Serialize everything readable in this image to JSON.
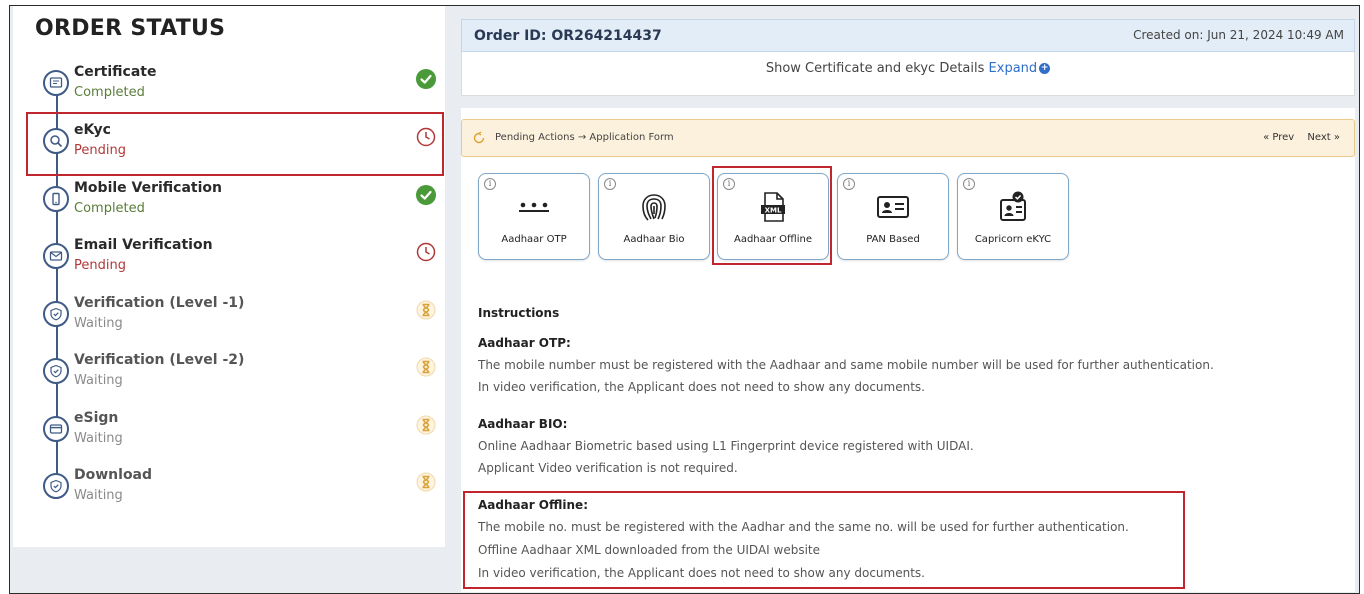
{
  "order_status": {
    "title": "ORDER STATUS",
    "steps": [
      {
        "title": "Certificate",
        "status": "Completed",
        "state": "done",
        "icon": "certificate-icon"
      },
      {
        "title": "eKyc",
        "status": "Pending",
        "state": "pending",
        "icon": "search-icon"
      },
      {
        "title": "Mobile Verification",
        "status": "Completed",
        "state": "done",
        "icon": "mobile-icon"
      },
      {
        "title": "Email Verification",
        "status": "Pending",
        "state": "pending",
        "icon": "mail-icon"
      },
      {
        "title": "Verification (Level -1)",
        "status": "Waiting",
        "state": "waiting",
        "icon": "shield-icon"
      },
      {
        "title": "Verification (Level -2)",
        "status": "Waiting",
        "state": "waiting",
        "icon": "shield-icon"
      },
      {
        "title": "eSign",
        "status": "Waiting",
        "state": "waiting",
        "icon": "card-icon"
      },
      {
        "title": "Download",
        "status": "Waiting",
        "state": "waiting",
        "icon": "shield-icon"
      }
    ]
  },
  "order": {
    "id_label": "Order ID: OR264214437",
    "created": "Created on: Jun 21, 2024 10:49 AM",
    "show_text": "Show Certificate and ekyc Details",
    "expand_label": "Expand"
  },
  "pending_actions": {
    "text": "Pending Actions → Application Form",
    "prev": "« Prev",
    "next": "Next »"
  },
  "methods": [
    {
      "label": "Aadhaar OTP",
      "icon": "dots-icon"
    },
    {
      "label": "Aadhaar Bio",
      "icon": "fingerprint-icon"
    },
    {
      "label": "Aadhaar Offline",
      "icon": "xml-file-icon"
    },
    {
      "label": "PAN Based",
      "icon": "id-card-icon"
    },
    {
      "label": "Capricorn eKYC",
      "icon": "verified-id-icon"
    }
  ],
  "instructions": {
    "title": "Instructions",
    "otp": {
      "heading": "Aadhaar OTP:",
      "lines": [
        "The mobile number must be registered with the Aadhaar and same mobile number will be used for further authentication.",
        "In video verification, the Applicant does not need to show any documents."
      ]
    },
    "bio": {
      "heading": "Aadhaar BIO:",
      "lines": [
        "Online Aadhaar Biometric based using L1 Fingerprint device registered with UIDAI.",
        "Applicant Video verification is not required."
      ]
    },
    "offline": {
      "heading": "Aadhaar Offline:",
      "lines": [
        "The mobile no. must be registered with the Aadhar and the same no. will be used for further authentication.",
        "Offline Aadhaar XML downloaded from the UIDAI website",
        "In video verification, the Applicant does not need to show any documents."
      ]
    }
  },
  "colors": {
    "accent": "#3f5a84",
    "completed": "#5a7d3a",
    "pending": "#b23838",
    "waiting": "#d9a23a",
    "highlight": "#c0262d",
    "link": "#2f6fc9"
  }
}
